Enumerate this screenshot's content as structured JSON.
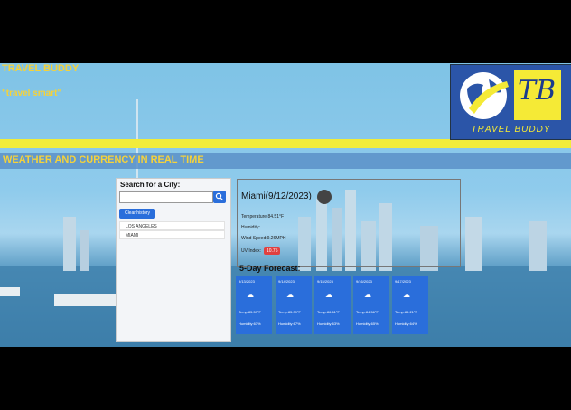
{
  "header": {
    "title": "TRAVEL BUDDY",
    "slogan": "\"travel smart\"",
    "banner": "WEATHER AND CURRENCY IN REAL TIME",
    "logo_letters": "TB",
    "logo_name": "TRAVEL BUDDY"
  },
  "search": {
    "label": "Search for a City:",
    "input_value": "",
    "clear_label": "Clear history",
    "history": [
      "LOS ANGELES",
      "MIAMI"
    ]
  },
  "current": {
    "city": "Miami(9/12/2023)",
    "temperature": "Temperature:84.51°F",
    "humidity": "Humidity:",
    "wind": "Wind Speed:9.26MPH",
    "uv_label": "UV Index:",
    "uv_value": "10.75"
  },
  "forecast_title": "5-Day Forecast:",
  "forecast": [
    {
      "date": "9/13/2023",
      "temp": "Temp:85.59°F",
      "humidity": "Humidity:63%"
    },
    {
      "date": "9/14/2023",
      "temp": "Temp:85.39°F",
      "humidity": "Humidity:67%"
    },
    {
      "date": "9/15/2023",
      "temp": "Temp:86.61°F",
      "humidity": "Humidity:63%"
    },
    {
      "date": "9/16/2023",
      "temp": "Temp:84.56°F",
      "humidity": "Humidity:65%"
    },
    {
      "date": "9/17/2023",
      "temp": "Temp:85.21°F",
      "humidity": "Humidity:64%"
    }
  ],
  "icons": {
    "search": "search-icon",
    "weather": "cloud-icon"
  }
}
